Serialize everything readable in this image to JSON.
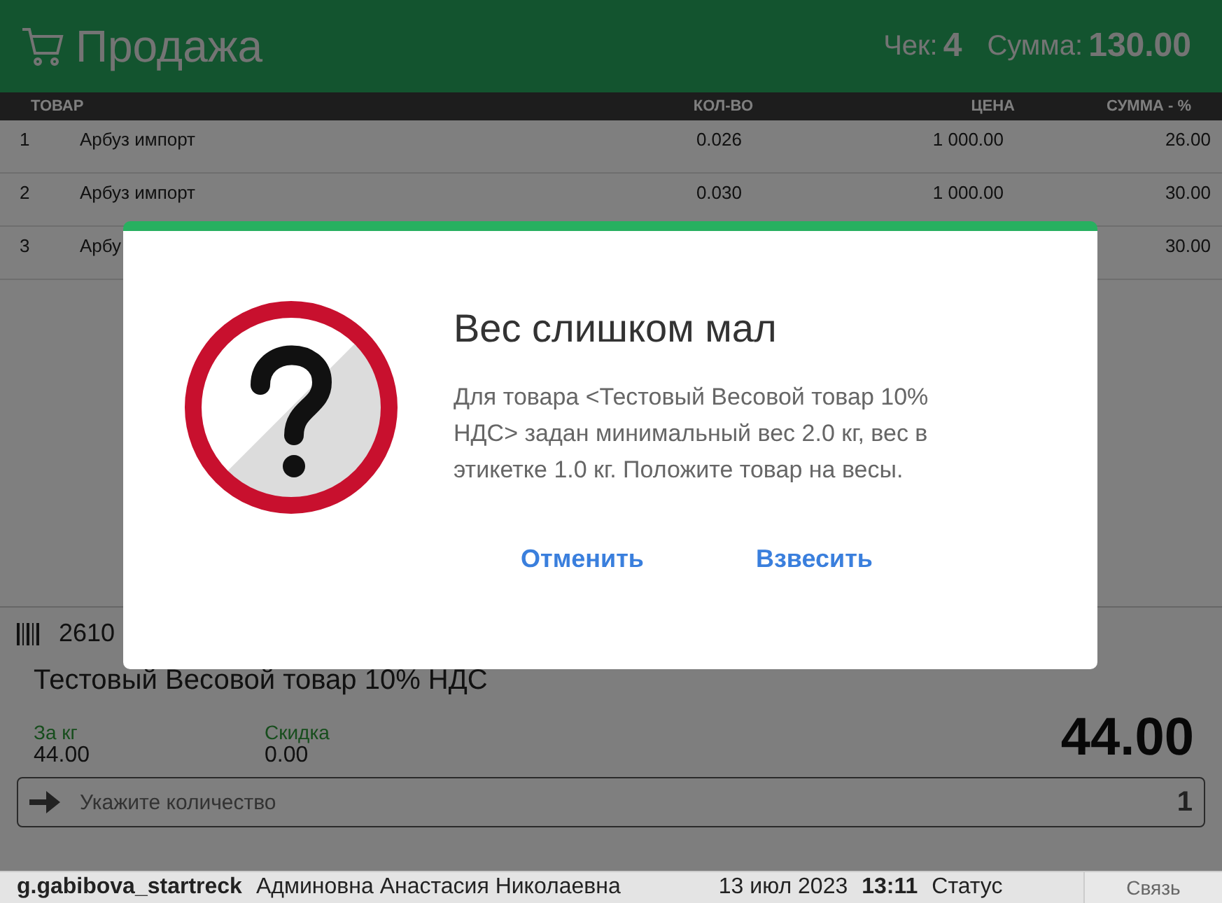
{
  "header": {
    "title": "Продажа",
    "receipt_label": "Чек:",
    "receipt_number": "4",
    "sum_label": "Сумма:",
    "sum_value": "130.00"
  },
  "table": {
    "columns": [
      "ТОВАР",
      "КОЛ-ВО",
      "ЦЕНА",
      "СУММА - %"
    ],
    "rows": [
      {
        "index": "1",
        "name": "Арбуз импорт",
        "qty": "0.026",
        "price": "1 000.00",
        "sum": "26.00"
      },
      {
        "index": "2",
        "name": "Арбуз импорт",
        "qty": "0.030",
        "price": "1 000.00",
        "sum": "30.00"
      },
      {
        "index": "3",
        "name": "Арбу",
        "qty": "",
        "price": "",
        "sum": "30.00"
      }
    ]
  },
  "item_panel": {
    "barcode": "2610",
    "name": "Тестовый Весовой товар 10% НДС",
    "per_kg_label": "За кг",
    "per_kg_value": "44.00",
    "discount_label": "Скидка",
    "discount_value": "0.00",
    "total": "44.00",
    "quantity_placeholder": "Укажите количество",
    "quantity_value": "1"
  },
  "status_bar": {
    "login": "g.gabibova_startreck",
    "user_name": "Админовна Анастасия Николаевна",
    "date": "13 июл 2023",
    "time": "13:11",
    "status": "Статус",
    "link_button": "Связь"
  },
  "dialog": {
    "title": "Вес слишком мал",
    "message": "Для товара <Тестовый Весовой товар 10% НДС> задан минимальный вес 2.0 кг, вес в этикетке 1.0 кг. Положите товар на весы.",
    "buttons": [
      "Отменить",
      "Взвесить"
    ]
  }
}
